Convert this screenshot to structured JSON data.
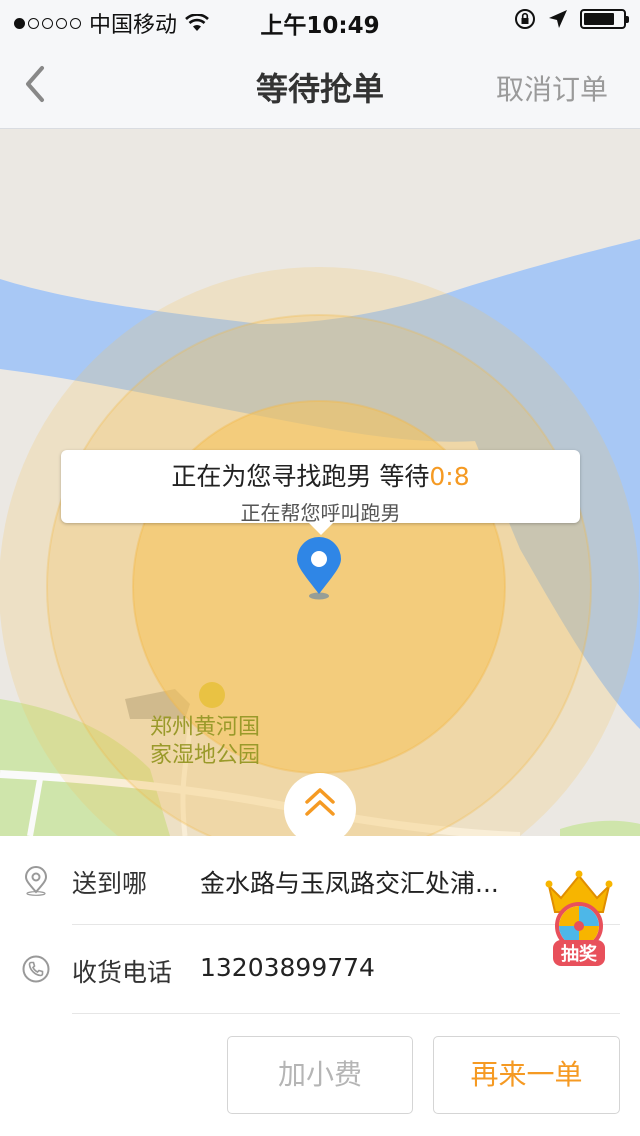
{
  "status_bar": {
    "carrier": "中国移动",
    "time": "上午10:49"
  },
  "nav": {
    "title": "等待抢单",
    "cancel_label": "取消订单"
  },
  "map": {
    "bubble_title": "正在为您寻找跑男 等待",
    "bubble_timer": "0:8",
    "bubble_subtitle": "正在帮您呼叫跑男",
    "park_name_line1": "郑州黄河国",
    "park_name_line2": "家湿地公园"
  },
  "order": {
    "destination_label": "送到哪",
    "destination_value": "金水路与玉凤路交汇处浦...",
    "phone_label": "收货电话",
    "phone_value": "13203899774"
  },
  "buttons": {
    "add_tip": "加小费",
    "reorder": "再来一单"
  },
  "lottery_label": "抽奖",
  "colors": {
    "accent": "#f59a23",
    "water": "#a8c8f5",
    "search_circle": "#f6c35a"
  }
}
